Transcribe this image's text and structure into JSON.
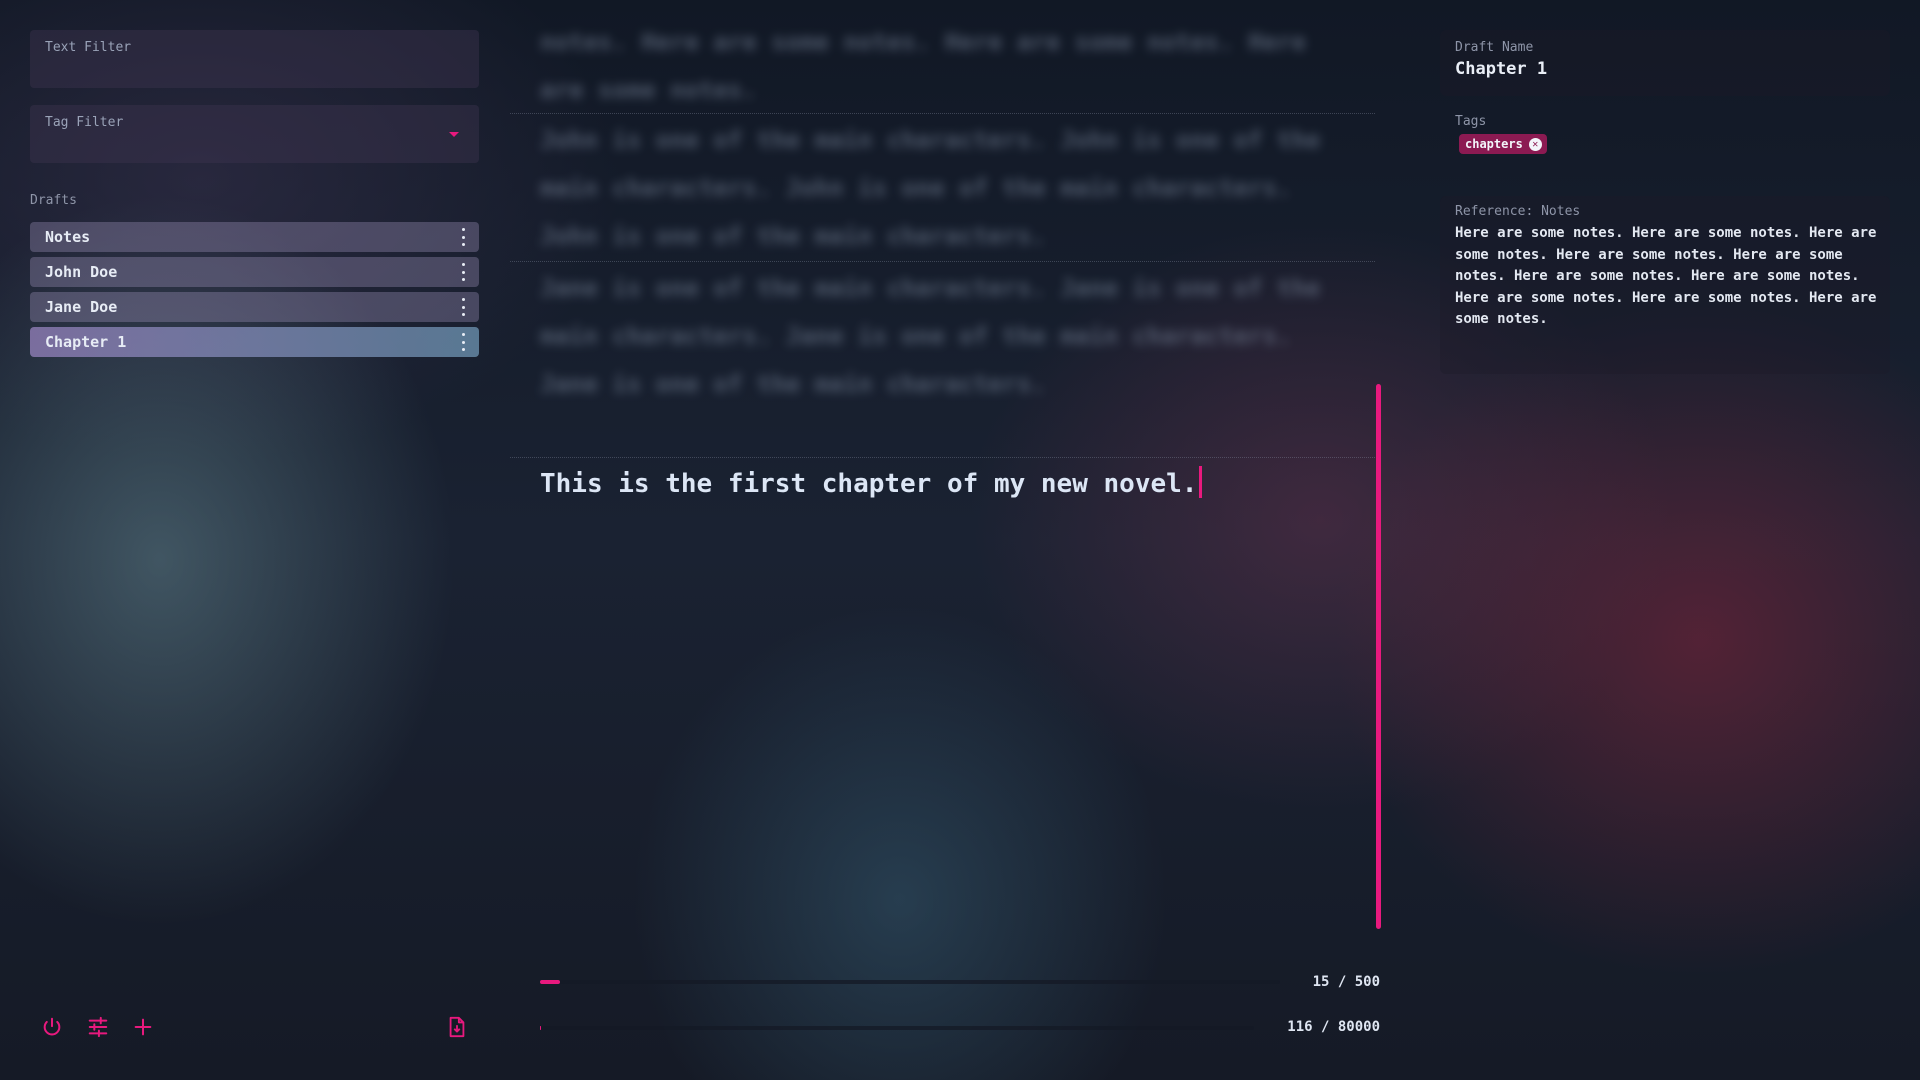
{
  "left_panel": {
    "text_filter_label": "Text Filter",
    "tag_filter_label": "Tag Filter",
    "drafts_label": "Drafts",
    "drafts": [
      {
        "name": "Notes",
        "active": false
      },
      {
        "name": "John Doe",
        "active": false
      },
      {
        "name": "Jane Doe",
        "active": false
      },
      {
        "name": "Chapter 1",
        "active": true
      }
    ],
    "bottom_icons": [
      "power-icon",
      "settings-sliders-icon",
      "plus-icon",
      "export-document-icon"
    ]
  },
  "editor": {
    "blurred_blocks": [
      "notes. Here are some notes. Here are some notes. Here are some notes.",
      "John is one of the main characters. John is one of the main characters. John is one of the main characters. John is one of the main characters.",
      "Jane is one of the main characters. Jane is one of the main characters. Jane is one of the main characters. Jane is one of the main characters."
    ],
    "current_text": "This is the first chapter of my new novel.",
    "session_progress": {
      "label": "15 / 500",
      "value": 15,
      "goal": 500
    },
    "total_progress": {
      "label": "116 / 80000",
      "value": 116,
      "goal": 80000
    },
    "accent_color": "#e8197e"
  },
  "right_panel": {
    "draft_name_label": "Draft Name",
    "draft_name": "Chapter 1",
    "tags_label": "Tags",
    "tags": [
      "chapters"
    ],
    "reference_label": "Reference: Notes",
    "reference_text": "Here are some notes. Here are some notes. Here are some notes. Here are some notes. Here are some notes. Here are some notes. Here are some notes. Here are some notes. Here are some notes. Here are some notes."
  }
}
